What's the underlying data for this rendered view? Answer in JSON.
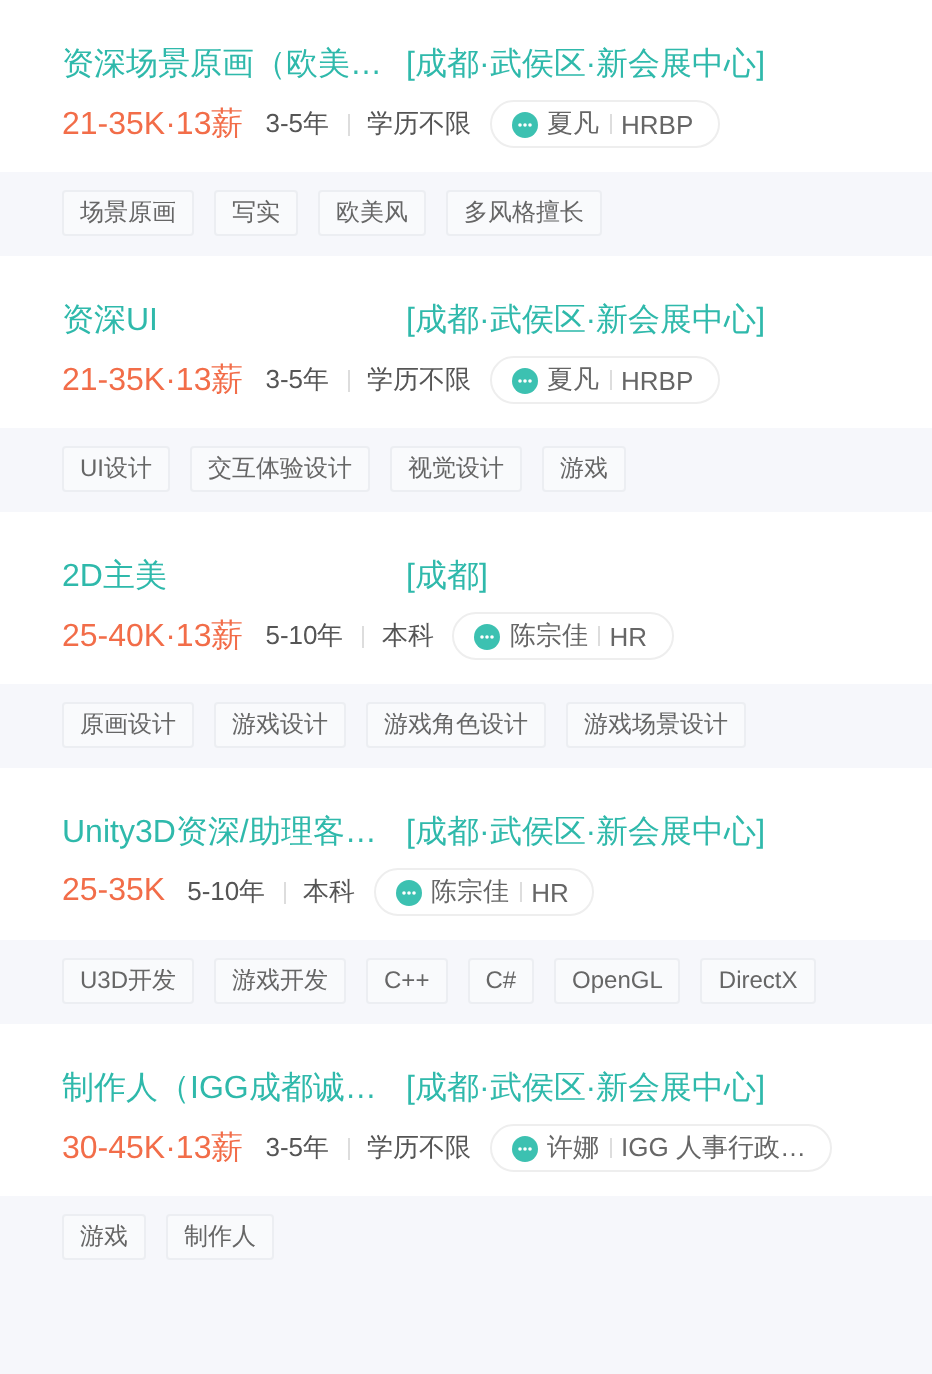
{
  "jobs": [
    {
      "title": "资深场景原画（欧美…",
      "location": "[成都·武侯区·新会展中心]",
      "salary": "21-35K·13薪",
      "experience": "3-5年",
      "education": "学历不限",
      "recruiter": {
        "name": "夏凡",
        "role": "HRBP"
      },
      "tags": [
        "场景原画",
        "写实",
        "欧美风",
        "多风格擅长"
      ]
    },
    {
      "title": "资深UI",
      "location": "[成都·武侯区·新会展中心]",
      "salary": "21-35K·13薪",
      "experience": "3-5年",
      "education": "学历不限",
      "recruiter": {
        "name": "夏凡",
        "role": "HRBP"
      },
      "tags": [
        "UI设计",
        "交互体验设计",
        "视觉设计",
        "游戏"
      ]
    },
    {
      "title": "2D主美",
      "location": "[成都]",
      "salary": "25-40K·13薪",
      "experience": "5-10年",
      "education": "本科",
      "recruiter": {
        "name": "陈宗佳",
        "role": "HR"
      },
      "tags": [
        "原画设计",
        "游戏设计",
        "游戏角色设计",
        "游戏场景设计"
      ]
    },
    {
      "title": "Unity3D资深/助理客…",
      "location": "[成都·武侯区·新会展中心]",
      "salary": "25-35K",
      "experience": "5-10年",
      "education": "本科",
      "recruiter": {
        "name": "陈宗佳",
        "role": "HR"
      },
      "tags": [
        "U3D开发",
        "游戏开发",
        "C++",
        "C#",
        "OpenGL",
        "DirectX"
      ]
    },
    {
      "title": "制作人（IGG成都诚…",
      "location": "[成都·武侯区·新会展中心]",
      "salary": "30-45K·13薪",
      "experience": "3-5年",
      "education": "学历不限",
      "recruiter": {
        "name": "许娜",
        "role": "IGG 人事行政…"
      },
      "tags": [
        "游戏",
        "制作人"
      ]
    }
  ]
}
